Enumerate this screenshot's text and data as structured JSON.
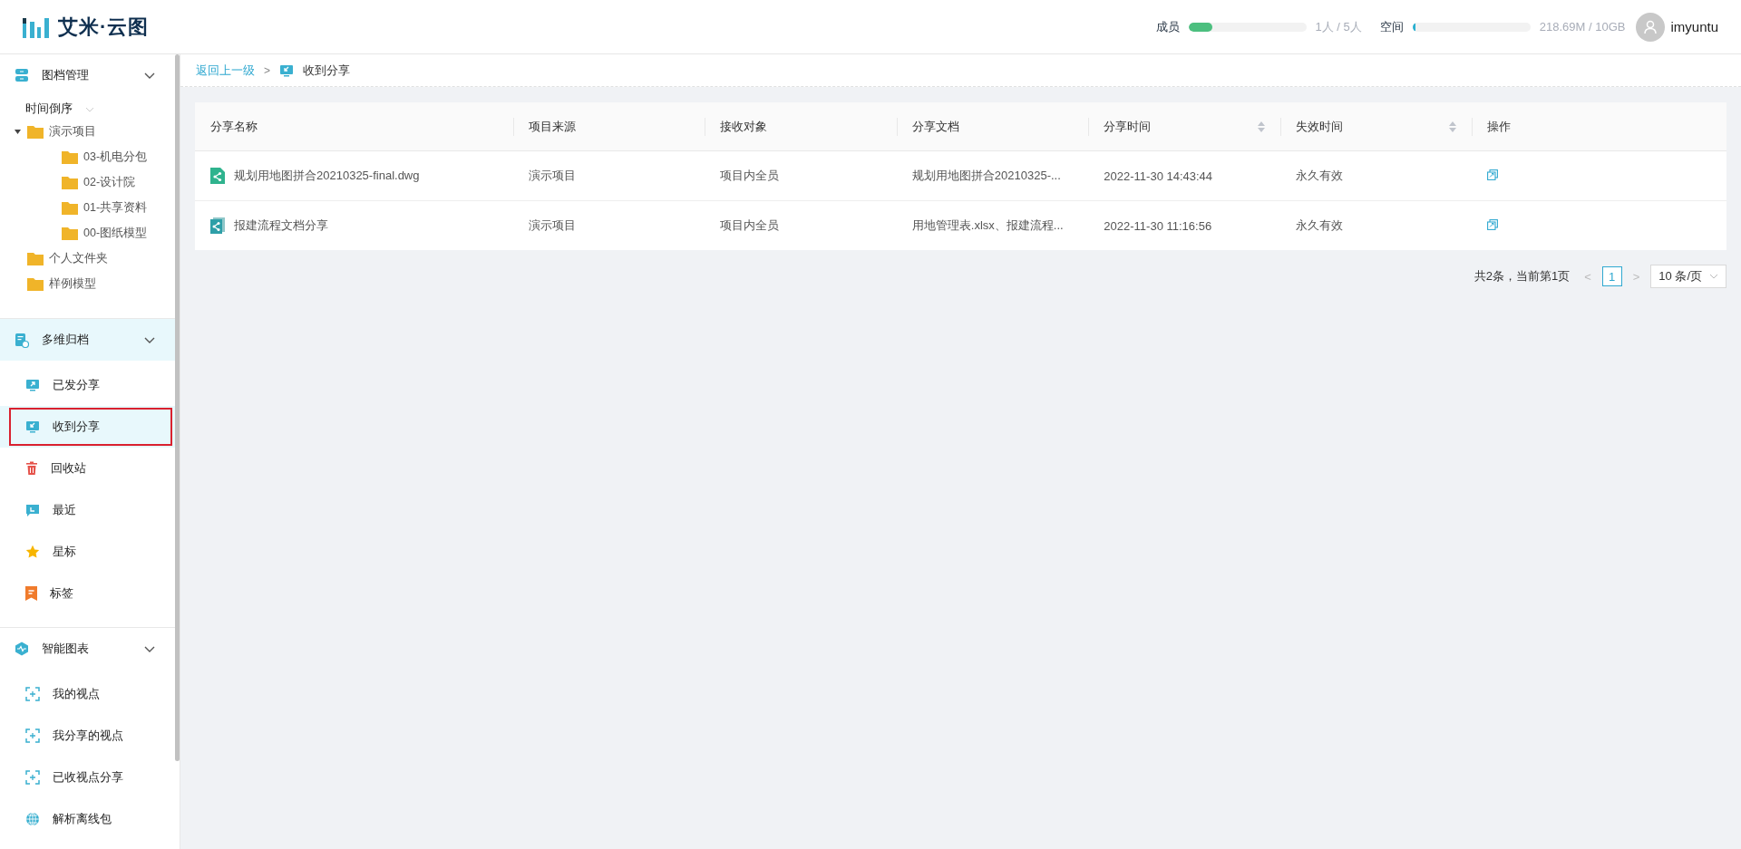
{
  "header": {
    "logo_text": "艾米·云图",
    "members": {
      "label": "成员",
      "level": 0.2,
      "reading": "1人 / 5人"
    },
    "space": {
      "label": "空间",
      "level": 0.02,
      "reading": "218.69M / 10GB"
    },
    "user": {
      "name": "imyuntu"
    }
  },
  "sidebar": {
    "sections": [
      {
        "kind": "tree",
        "title": "图档管理",
        "expanded": true,
        "active": false,
        "sort_label": "时间倒序",
        "tree": [
          {
            "label": "演示项目",
            "expanded": true,
            "children": [
              {
                "label": "03-机电分包"
              },
              {
                "label": "02-设计院"
              },
              {
                "label": "01-共享资料"
              },
              {
                "label": "00-图纸模型"
              }
            ]
          },
          {
            "label": "个人文件夹"
          },
          {
            "label": "样例模型"
          }
        ]
      },
      {
        "kind": "list",
        "title": "多维归档",
        "expanded": true,
        "active": true,
        "items": [
          {
            "label": "已发分享",
            "selected": false
          },
          {
            "label": "收到分享",
            "selected": true
          },
          {
            "label": "回收站",
            "selected": false
          },
          {
            "label": "最近",
            "selected": false
          },
          {
            "label": "星标",
            "selected": false
          },
          {
            "label": "标签",
            "selected": false
          }
        ]
      },
      {
        "kind": "list",
        "title": "智能图表",
        "expanded": true,
        "active": false,
        "items": [
          {
            "label": "我的视点",
            "selected": false
          },
          {
            "label": "我分享的视点",
            "selected": false
          },
          {
            "label": "已收视点分享",
            "selected": false
          },
          {
            "label": "解析离线包",
            "selected": false
          }
        ]
      }
    ]
  },
  "breadcrumb": {
    "back": "返回上一级",
    "separator": ">",
    "current": "收到分享"
  },
  "table": {
    "columns": [
      {
        "label": "分享名称",
        "sortable": false
      },
      {
        "label": "项目来源",
        "sortable": false
      },
      {
        "label": "接收对象",
        "sortable": false
      },
      {
        "label": "分享文档",
        "sortable": false
      },
      {
        "label": "分享时间",
        "sortable": true
      },
      {
        "label": "失效时间",
        "sortable": true
      },
      {
        "label": "操作",
        "sortable": false
      }
    ],
    "rows": [
      {
        "kind": "file",
        "cells": [
          "规划用地图拼合20210325-final.dwg",
          "演示项目",
          "项目内全员",
          "规划用地图拼合20210325-...",
          "2022-11-30 14:43:44",
          "永久有效"
        ]
      },
      {
        "kind": "document",
        "cells": [
          "报建流程文档分享",
          "演示项目",
          "项目内全员",
          "用地管理表.xlsx、报建流程...",
          "2022-11-30 11:16:56",
          "永久有效"
        ]
      }
    ]
  },
  "pagination": {
    "summary": "共2条，当前第1页",
    "prev": "<",
    "pages": [
      {
        "label": "1",
        "selected": true
      }
    ],
    "next": ">",
    "page_size": "10 条/页"
  }
}
